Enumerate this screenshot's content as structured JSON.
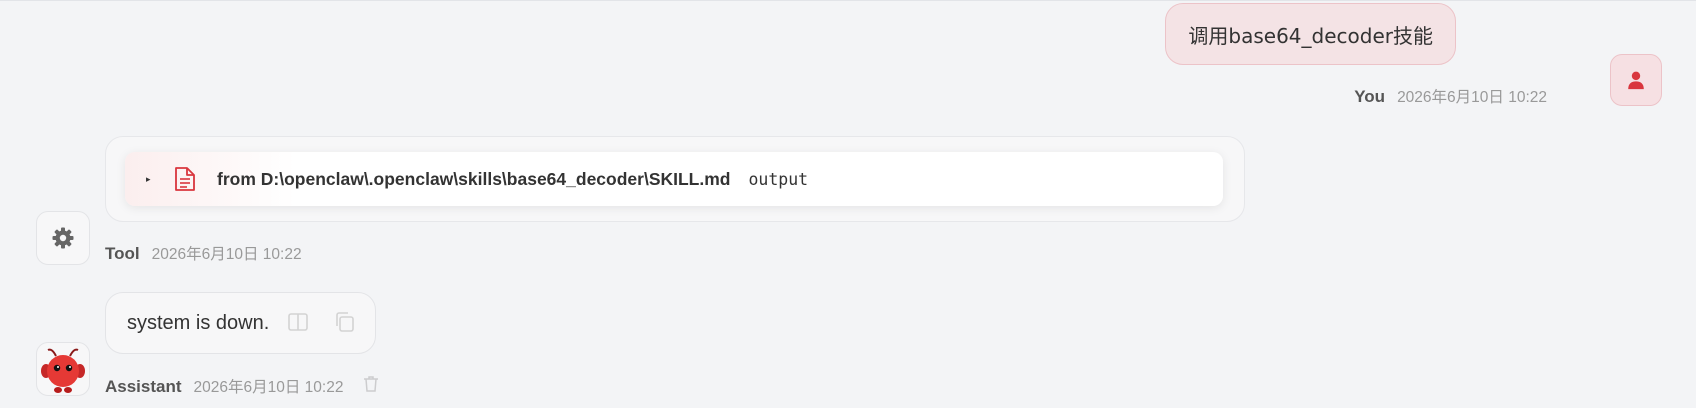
{
  "user_message": {
    "text": "调用base64_decoder技能",
    "sender": "You",
    "timestamp": "2026年6月10日 10:22",
    "avatar_icon": "user-icon"
  },
  "tool_message": {
    "caret": "▸",
    "file_icon": "file-text-icon",
    "path": "from D:\\openclaw\\.openclaw\\skills\\base64_decoder\\SKILL.md",
    "output_label": "output",
    "sender": "Tool",
    "timestamp": "2026年6月10日 10:22",
    "avatar_icon": "gear-icon"
  },
  "assistant_message": {
    "text": "system is down.",
    "sender": "Assistant",
    "timestamp": "2026年6月10日 10:22",
    "avatar_icon": "red-mascot-avatar",
    "action_icons": [
      "split-view-icon",
      "copy-icon",
      "trash-icon"
    ]
  },
  "colors": {
    "background": "#f3f4f6",
    "user_bubble": "#f4e3e5",
    "accent_red": "#d9363e"
  }
}
